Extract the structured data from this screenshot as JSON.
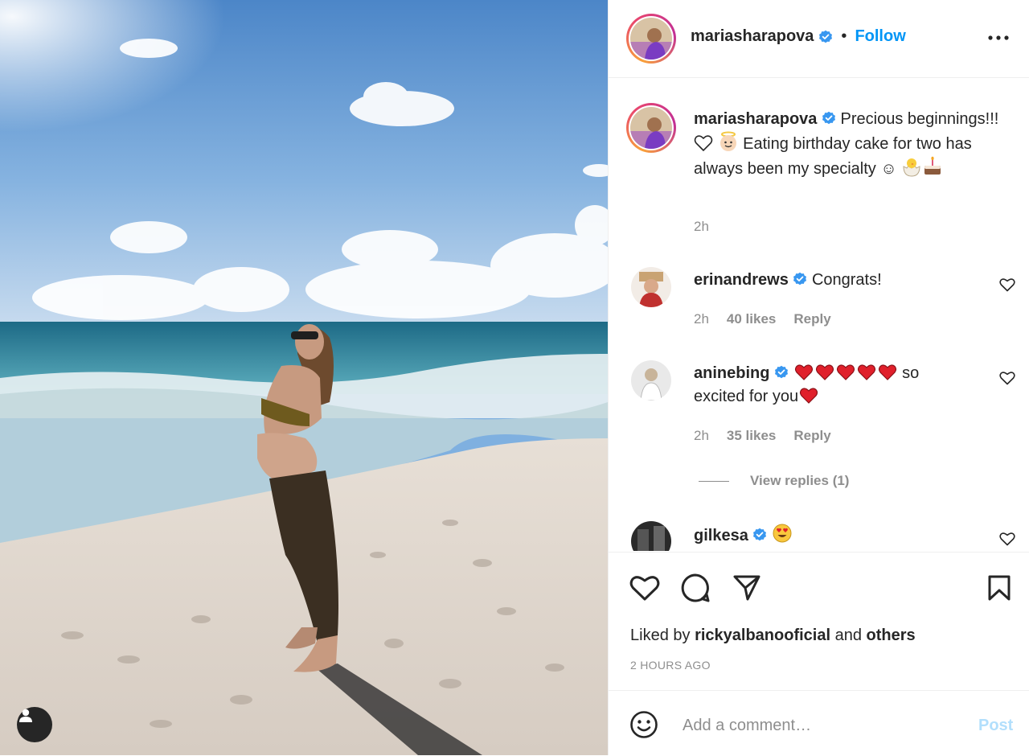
{
  "post": {
    "author": "mariasharapova",
    "follow_label": "Follow",
    "separator": "•",
    "more_icon": "more-horizontal-icon",
    "caption": {
      "username": "mariasharapova",
      "text_1": "Precious beginnings!!! ",
      "text_2": " Eating birthday cake for two has always been my specialty ☺",
      "time": "2h"
    },
    "liked_by_prefix": "Liked by ",
    "liked_by_user": "rickyalbanooficial",
    "liked_by_middle": " and ",
    "liked_by_suffix": "others",
    "posted_ago": "2 HOURS AGO"
  },
  "comments": [
    {
      "username": "erinandrews",
      "text": "Congrats!",
      "time": "2h",
      "likes": "40 likes",
      "reply_label": "Reply"
    },
    {
      "username": "aninebing",
      "text_1": "so",
      "text_2": "excited for you",
      "time": "2h",
      "likes": "35 likes",
      "reply_label": "Reply"
    },
    {
      "username": "gilkesa",
      "text": ""
    }
  ],
  "view_replies": "View replies (1)",
  "composer": {
    "placeholder": "Add a comment…",
    "post_label": "Post"
  },
  "colors": {
    "follow_blue": "#0095f6",
    "verified_blue": "#3897f0",
    "muted": "#8e8e8e",
    "post_disabled": "#b2dffc"
  },
  "icons": [
    "heart-icon",
    "comment-icon",
    "share-icon",
    "bookmark-icon",
    "emoji-icon",
    "user-tag-icon",
    "verified-badge-icon"
  ]
}
